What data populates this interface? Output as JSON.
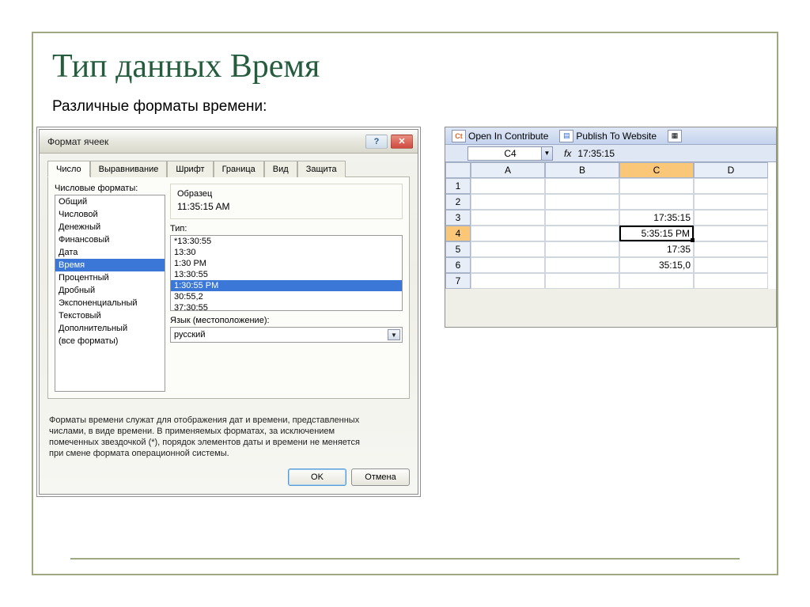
{
  "slide": {
    "title": "Тип данных Время",
    "subtitle": "Различные форматы времени:"
  },
  "dialog": {
    "title": "Формат ячеек",
    "tabs": [
      "Число",
      "Выравнивание",
      "Шрифт",
      "Граница",
      "Вид",
      "Защита"
    ],
    "formats_label": "Числовые форматы:",
    "format_items": [
      "Общий",
      "Числовой",
      "Денежный",
      "Финансовый",
      "Дата",
      "Время",
      "Процентный",
      "Дробный",
      "Экспоненциальный",
      "Текстовый",
      "Дополнительный",
      "(все форматы)"
    ],
    "format_selected": 5,
    "sample_label": "Образец",
    "sample_value": "11:35:15 AM",
    "type_label": "Тип:",
    "type_items": [
      "*13:30:55",
      "13:30",
      "1:30 PM",
      "13:30:55",
      "1:30:55 PM",
      "30:55,2",
      "37:30:55"
    ],
    "type_selected": 4,
    "lang_label": "Язык (местоположение):",
    "lang_value": "русский",
    "description_l1": "Форматы времени служат для отображения дат и времени, представленных",
    "description_l2": "числами, в виде времени. В применяемых форматах, за исключением",
    "description_l3": "помеченных звездочкой (*), порядок элементов даты и времени не меняется",
    "description_l4": "при смене формата операционной системы.",
    "ok": "OK",
    "cancel": "Отмена"
  },
  "excel": {
    "contribute": "Open In Contribute",
    "publish": "Publish To Website",
    "namebox": "C4",
    "fx_label": "fx",
    "fx_value": "17:35:15",
    "columns": [
      "A",
      "B",
      "C",
      "D"
    ],
    "rows": [
      "1",
      "2",
      "3",
      "4",
      "5",
      "6",
      "7"
    ],
    "cells": {
      "C3": "17:35:15",
      "C4": "5:35:15 PM",
      "C5": "17:35",
      "C6": "35:15,0"
    },
    "selected": {
      "col": "C",
      "row": "4"
    }
  }
}
